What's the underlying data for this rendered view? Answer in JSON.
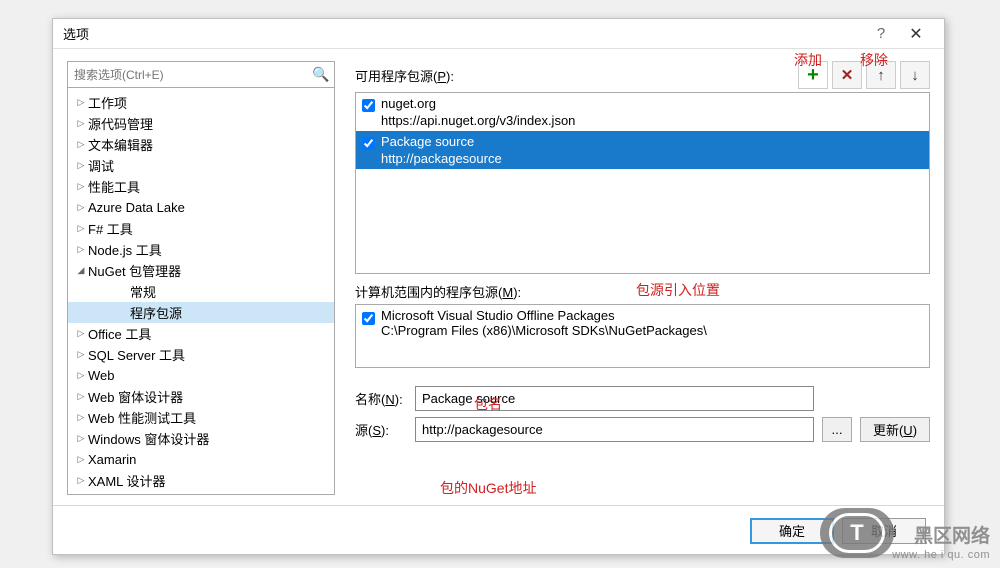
{
  "title": "选项",
  "search": {
    "placeholder": "搜索选项(Ctrl+E)"
  },
  "tree": {
    "items": [
      {
        "label": "工作项",
        "level": 1
      },
      {
        "label": "源代码管理",
        "level": 1
      },
      {
        "label": "文本编辑器",
        "level": 1
      },
      {
        "label": "调试",
        "level": 1
      },
      {
        "label": "性能工具",
        "level": 1
      },
      {
        "label": "Azure Data Lake",
        "level": 1
      },
      {
        "label": "F# 工具",
        "level": 1
      },
      {
        "label": "Node.js 工具",
        "level": 1
      },
      {
        "label": "NuGet 包管理器",
        "level": 1,
        "expanded": true
      },
      {
        "label": "常规",
        "level": 2
      },
      {
        "label": "程序包源",
        "level": 2,
        "selected": true
      },
      {
        "label": "Office 工具",
        "level": 1
      },
      {
        "label": "SQL Server 工具",
        "level": 1
      },
      {
        "label": "Web",
        "level": 1
      },
      {
        "label": "Web 窗体设计器",
        "level": 1
      },
      {
        "label": "Web 性能测试工具",
        "level": 1
      },
      {
        "label": "Windows 窗体设计器",
        "level": 1
      },
      {
        "label": "Xamarin",
        "level": 1
      },
      {
        "label": "XAML 设计器",
        "level": 1
      }
    ]
  },
  "right": {
    "available_label_pre": "可用程序包源(",
    "available_label_key": "P",
    "available_label_post": "):",
    "sources": [
      {
        "name": "nuget.org",
        "url": "https://api.nuget.org/v3/index.json",
        "checked": true,
        "selected": false
      },
      {
        "name": "Package source",
        "url": "http://packagesource",
        "checked": true,
        "selected": true
      }
    ],
    "machine_label_pre": "计算机范围内的程序包源(",
    "machine_label_key": "M",
    "machine_label_post": "):",
    "machine_sources": [
      {
        "name": "Microsoft Visual Studio Offline Packages",
        "path": "C:\\Program Files (x86)\\Microsoft SDKs\\NuGetPackages\\",
        "checked": true
      }
    ],
    "name_label_pre": "名称(",
    "name_label_key": "N",
    "name_label_post": "):",
    "name_value": "Package source",
    "src_label_pre": "源(",
    "src_label_key": "S",
    "src_label_post": "):",
    "src_value": "http://packagesource",
    "browse_label": "...",
    "update_label_pre": "更新(",
    "update_label_key": "U",
    "update_label_post": ")"
  },
  "footer": {
    "ok": "确定",
    "cancel": "取消"
  },
  "annotations": {
    "add": "添加",
    "remove": "移除",
    "src_position": "包源引入位置",
    "package_name": "包名",
    "nuget_url": "包的NuGet地址"
  },
  "watermark": {
    "logo": "T",
    "line1": "黑区网络",
    "line2": "www. he i qu. com"
  }
}
